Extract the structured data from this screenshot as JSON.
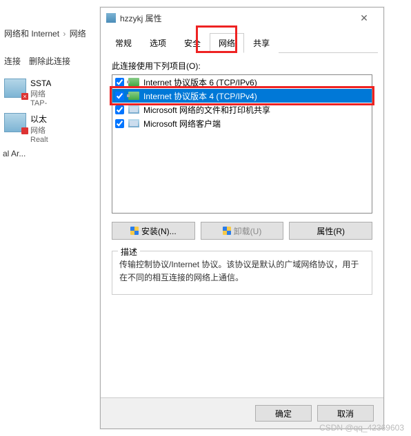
{
  "breadcrumb": {
    "seg1": "网络和 Internet",
    "seg2": "网络"
  },
  "toolbar": {
    "diag": "连接",
    "del": "删除此连接"
  },
  "left_label": "al Ar...",
  "connections": [
    {
      "name": "SSTA",
      "sub1": "网络",
      "sub2": "TAP-"
    },
    {
      "name": "以太",
      "sub1": "网络",
      "sub2": "Realt"
    }
  ],
  "dialog": {
    "title": "hzzykj 属性",
    "tabs": [
      "常规",
      "选项",
      "安全",
      "网络",
      "共享"
    ],
    "active_tab": 3,
    "list_label": "此连接使用下列项目(O):",
    "items": [
      {
        "label": "Internet 协议版本 6 (TCP/IPv6)",
        "checked": true,
        "icon": "net"
      },
      {
        "label": "Internet 协议版本 4 (TCP/IPv4)",
        "checked": true,
        "icon": "net",
        "selected": true
      },
      {
        "label": "Microsoft 网络的文件和打印机共享",
        "checked": true,
        "icon": "share"
      },
      {
        "label": "Microsoft 网络客户端",
        "checked": true,
        "icon": "share"
      }
    ],
    "buttons": {
      "install": "安装(N)...",
      "uninstall": "卸载(U)",
      "properties": "属性(R)"
    },
    "desc_legend": "描述",
    "desc_text": "传输控制协议/Internet 协议。该协议是默认的广域网络协议，用于在不同的相互连接的网络上通信。",
    "ok": "确定",
    "cancel": "取消"
  },
  "watermark": "CSDN @qq_42369603"
}
